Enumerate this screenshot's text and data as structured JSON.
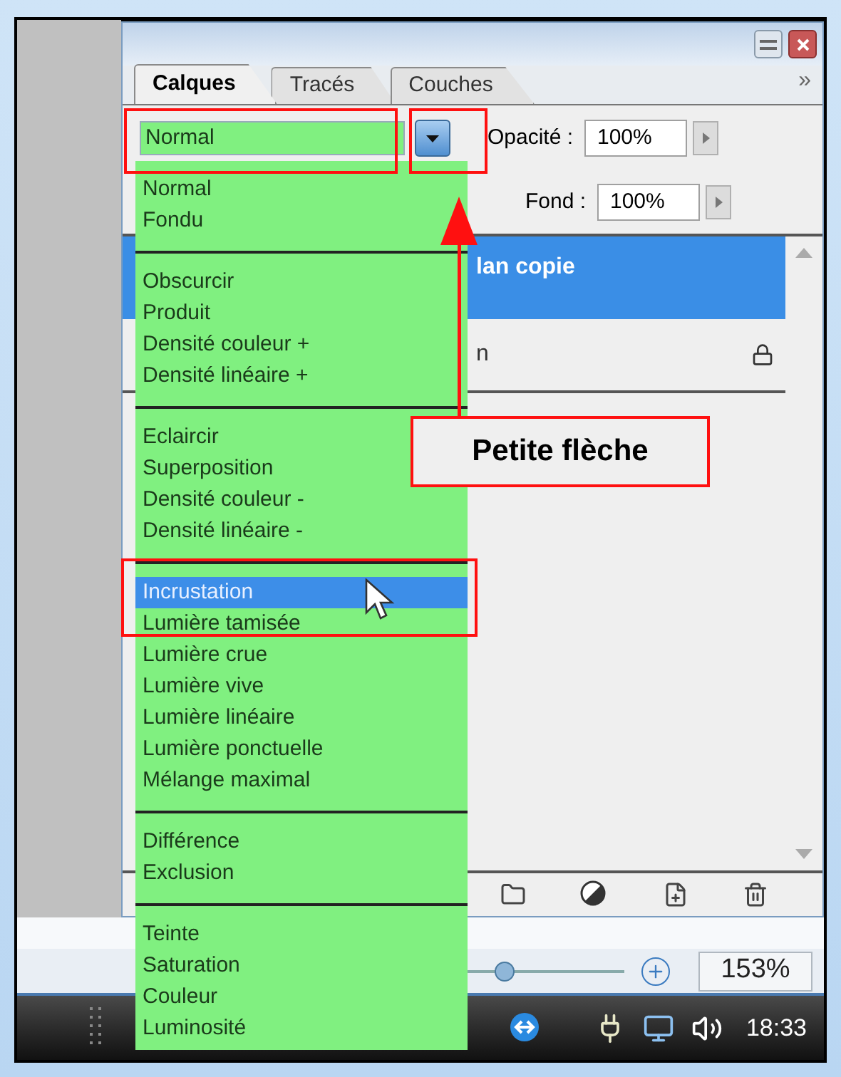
{
  "panel": {
    "tabs": [
      {
        "label": "Calques",
        "selected": true
      },
      {
        "label": "Tracés",
        "selected": false
      },
      {
        "label": "Couches",
        "selected": false
      }
    ],
    "menu_glyph": "»"
  },
  "blend_field": {
    "value": "Normal"
  },
  "opacity": {
    "label": "Opacité :",
    "value": "100%"
  },
  "fill": {
    "label": "Fond :",
    "value": "100%"
  },
  "layers": [
    {
      "name": "lan copie",
      "selected": true,
      "locked": false
    },
    {
      "name": "n",
      "selected": false,
      "locked": true
    }
  ],
  "blend_menu": {
    "groups": [
      {
        "items": [
          {
            "label": "Normal",
            "selected": false
          },
          {
            "label": "Fondu",
            "selected": false
          }
        ]
      },
      {
        "items": [
          {
            "label": "Obscurcir",
            "selected": false
          },
          {
            "label": "Produit",
            "selected": false
          },
          {
            "label": "Densité couleur +",
            "selected": false
          },
          {
            "label": "Densité linéaire +",
            "selected": false
          }
        ]
      },
      {
        "items": [
          {
            "label": "Eclaircir",
            "selected": false
          },
          {
            "label": "Superposition",
            "selected": false
          },
          {
            "label": "Densité couleur -",
            "selected": false
          },
          {
            "label": "Densité linéaire -",
            "selected": false
          }
        ]
      },
      {
        "items": [
          {
            "label": "Incrustation",
            "selected": true
          },
          {
            "label": "Lumière tamisée",
            "selected": false
          },
          {
            "label": "Lumière crue",
            "selected": false
          },
          {
            "label": "Lumière vive",
            "selected": false
          },
          {
            "label": "Lumière linéaire",
            "selected": false
          },
          {
            "label": "Lumière ponctuelle",
            "selected": false
          },
          {
            "label": "Mélange maximal",
            "selected": false
          }
        ]
      },
      {
        "items": [
          {
            "label": "Différence",
            "selected": false
          },
          {
            "label": "Exclusion",
            "selected": false
          }
        ]
      },
      {
        "items": [
          {
            "label": "Teinte",
            "selected": false
          },
          {
            "label": "Saturation",
            "selected": false
          },
          {
            "label": "Couleur",
            "selected": false
          },
          {
            "label": "Luminosité",
            "selected": false
          }
        ]
      }
    ]
  },
  "zoom": {
    "value": "153%",
    "level": 0.3
  },
  "taskbar": {
    "clock": "18:33"
  },
  "callout": {
    "text": "Petite flèche"
  }
}
